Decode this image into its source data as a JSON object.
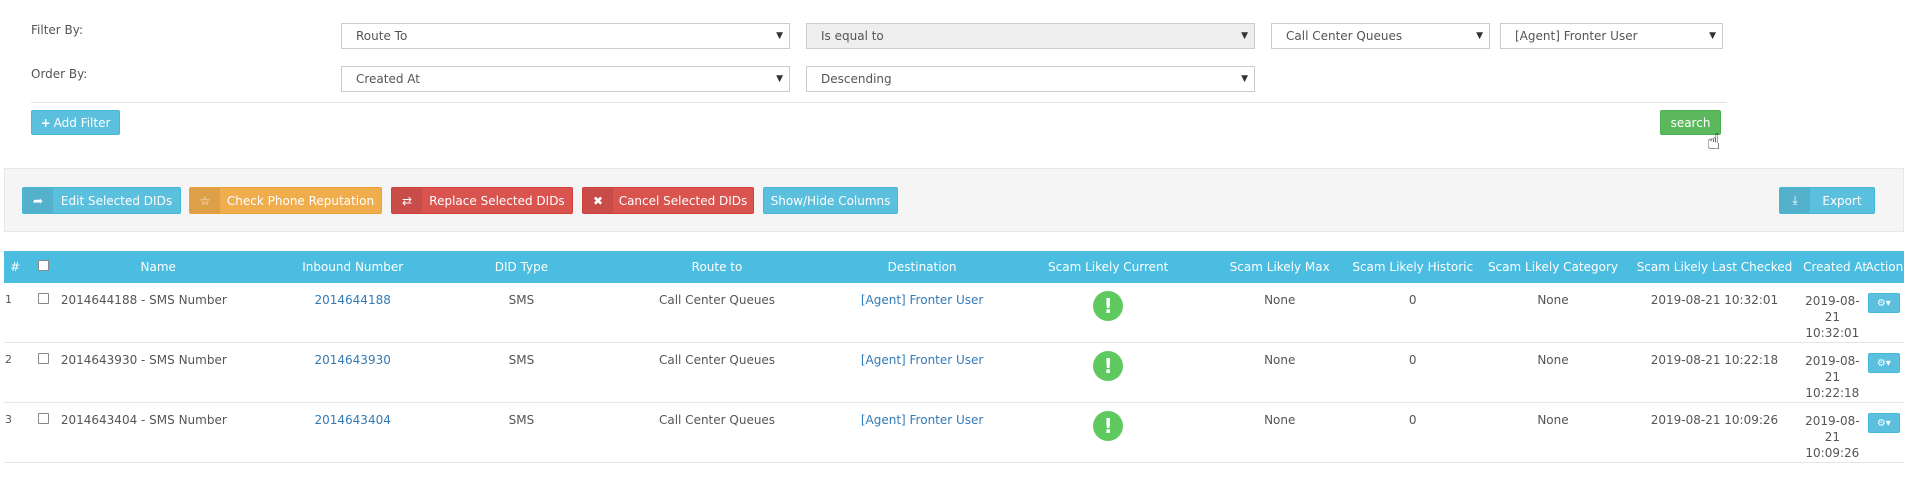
{
  "filters": {
    "filter_by_label": "Filter By:",
    "order_by_label": "Order By:",
    "filter_field": "Route To",
    "filter_operator": "Is equal to",
    "filter_value_1": "Call Center Queues",
    "filter_value_2": "[Agent] Fronter User",
    "order_field": "Created At",
    "order_direction": "Descending",
    "add_filter_label": "Add Filter",
    "search_label": "search"
  },
  "toolbar": {
    "edit_label": "Edit Selected DIDs",
    "reputation_label": "Check Phone Reputation",
    "replace_label": "Replace Selected DIDs",
    "cancel_label": "Cancel Selected DIDs",
    "show_hide_label": "Show/Hide Columns",
    "export_label": "Export"
  },
  "table": {
    "headers": {
      "num": "#",
      "name": "Name",
      "inbound": "Inbound Number",
      "did_type": "DID Type",
      "route_to": "Route to",
      "destination": "Destination",
      "scam_current": "Scam Likely Current",
      "scam_max": "Scam Likely Max",
      "scam_historic": "Scam Likely Historic",
      "scam_category": "Scam Likely Category",
      "scam_last_checked": "Scam Likely Last Checked",
      "created_at": "Created At",
      "action": "Action"
    },
    "rows": [
      {
        "num": "1",
        "name": "2014644188 - SMS Number",
        "inbound": "2014644188",
        "did_type": "SMS",
        "route_to": "Call Center Queues",
        "destination": "[Agent] Fronter User",
        "scam_current": "!",
        "scam_max": "None",
        "scam_historic": "0",
        "scam_category": "None",
        "scam_last_checked": "2019-08-21 10:32:01",
        "created_date": "2019-08-",
        "created_day": "21",
        "created_time": "10:32:01"
      },
      {
        "num": "2",
        "name": "2014643930 - SMS Number",
        "inbound": "2014643930",
        "did_type": "SMS",
        "route_to": "Call Center Queues",
        "destination": "[Agent] Fronter User",
        "scam_current": "!",
        "scam_max": "None",
        "scam_historic": "0",
        "scam_category": "None",
        "scam_last_checked": "2019-08-21 10:22:18",
        "created_date": "2019-08-",
        "created_day": "21",
        "created_time": "10:22:18"
      },
      {
        "num": "3",
        "name": "2014643404 - SMS Number",
        "inbound": "2014643404",
        "did_type": "SMS",
        "route_to": "Call Center Queues",
        "destination": "[Agent] Fronter User",
        "scam_current": "!",
        "scam_max": "None",
        "scam_historic": "0",
        "scam_category": "None",
        "scam_last_checked": "2019-08-21 10:09:26",
        "created_date": "2019-08-",
        "created_day": "21",
        "created_time": "10:09:26"
      }
    ]
  },
  "colors": {
    "info": "#5bc0de",
    "success": "#5cb85c",
    "warning": "#f0ad4e",
    "danger": "#d9534f",
    "table_header": "#4bbde1",
    "scam_badge": "#5ec95e",
    "link": "#337ab7"
  },
  "icons": {
    "add_filter": "plus-icon",
    "edit": "share-icon",
    "reputation": "star-icon",
    "replace": "retweet-icon",
    "cancel": "times-icon",
    "export": "download-icon",
    "action": "gear-icon",
    "scam": "exclamation-icon"
  }
}
